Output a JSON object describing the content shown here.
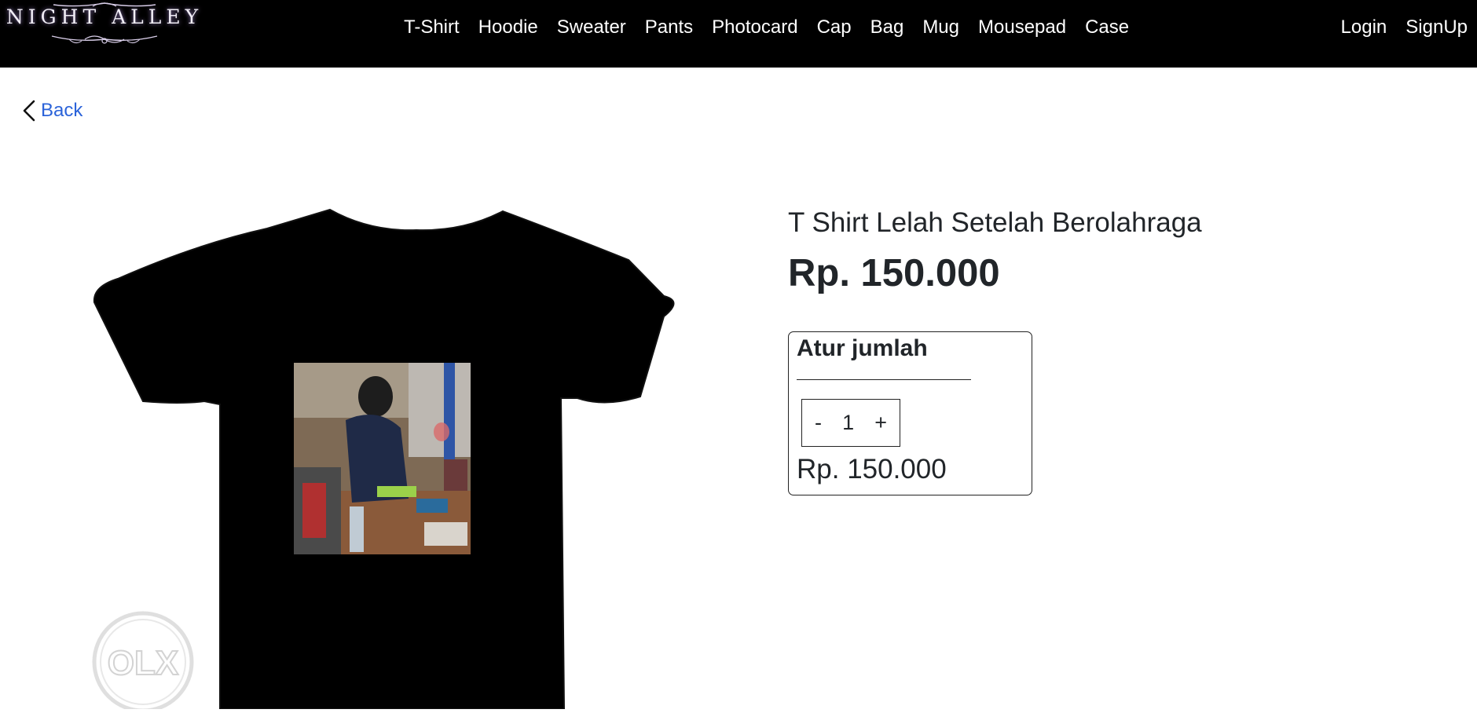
{
  "brand": {
    "name": "NIGHT ALLEY"
  },
  "nav": {
    "categories": [
      "T-Shirt",
      "Hoodie",
      "Sweater",
      "Pants",
      "Photocard",
      "Cap",
      "Bag",
      "Mug",
      "Mousepad",
      "Case"
    ],
    "login_label": "Login",
    "signup_label": "SignUp"
  },
  "back_label": "Back",
  "product": {
    "title": "T Shirt Lelah Setelah Berolahraga",
    "price": "Rp. 150.000",
    "watermark": "OLX"
  },
  "quantity": {
    "heading": "Atur jumlah",
    "minus_label": "-",
    "value": "1",
    "plus_label": "+",
    "subtotal": "Rp. 150.000"
  },
  "colors": {
    "navbar": "#000000",
    "link": "#2b63d9",
    "text": "#212529"
  }
}
